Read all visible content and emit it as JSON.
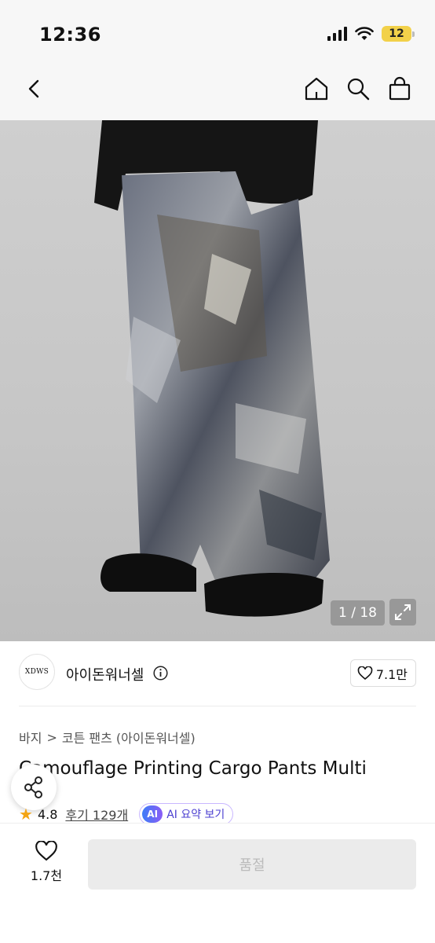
{
  "status_bar": {
    "time": "12:36",
    "battery": "12"
  },
  "nav": {
    "icons": [
      "chevron-left-icon",
      "home-icon",
      "search-icon",
      "shopping-bag-icon"
    ]
  },
  "gallery": {
    "pager": "1 / 18"
  },
  "brand": {
    "logo_text": "XDWS",
    "name": "아이돈워너셀",
    "likes": "7.1만"
  },
  "breadcrumb": {
    "category": "바지",
    "separator": ">",
    "subcategory": "코튼 팬츠 (아이돈워너셀)"
  },
  "product": {
    "title": "Camouflage Printing Cargo Pants Multi",
    "rating": "4.8",
    "reviews": "후기 129개",
    "ai_label": "AI",
    "ai_summary": "AI 요약 보기"
  },
  "bottom_bar": {
    "wish_count": "1.7천",
    "buy_label": "품절"
  },
  "colors": {
    "star": "#f3a412",
    "ai_text": "#4b3fd1",
    "battery": "#f2d14a"
  }
}
